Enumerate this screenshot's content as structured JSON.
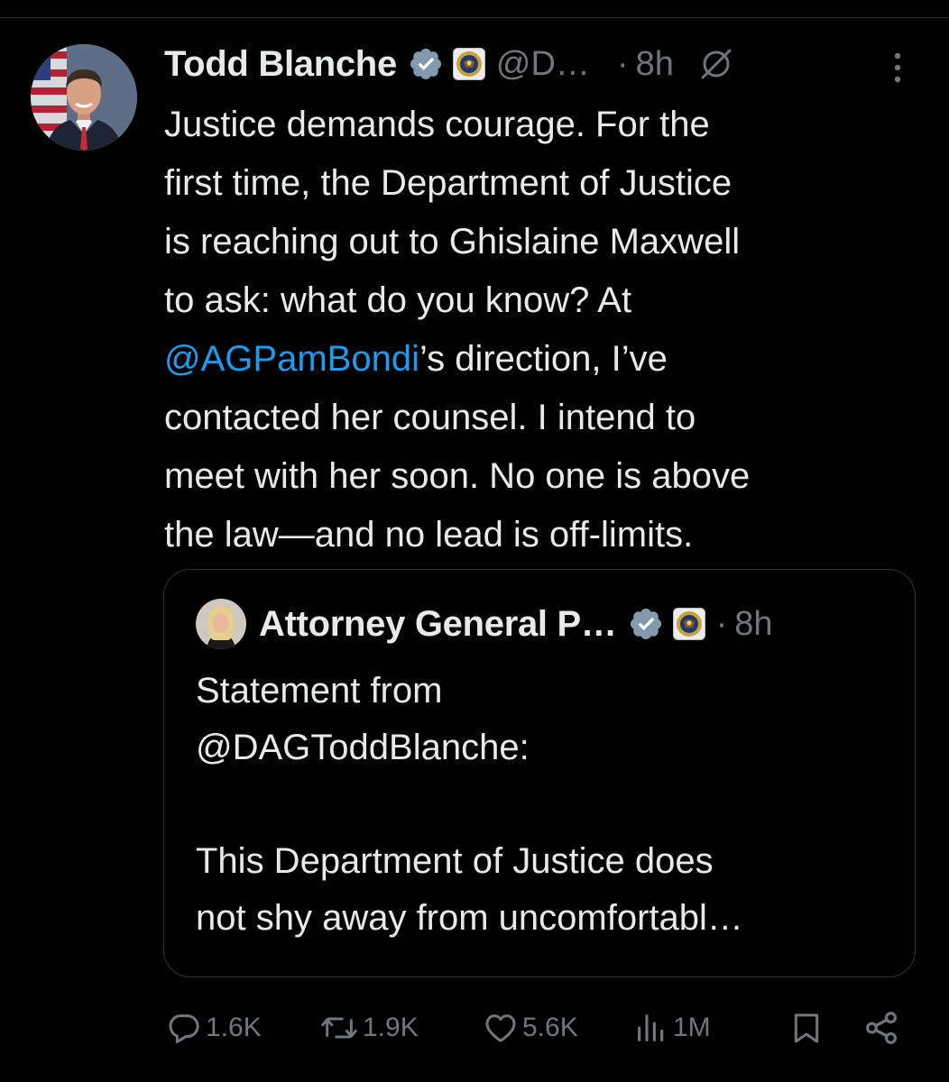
{
  "tweet": {
    "author_name": "Todd Blanche",
    "handle": "@D…",
    "separator": "·",
    "time": "8h",
    "text_lines": [
      "Justice demands courage. For the",
      "first time, the Department of Justice",
      "is reaching out to Ghislaine Maxwell",
      "to ask: what do you know? At"
    ],
    "mention": "@AGPamBondi",
    "after_mention": "’s direction, I’ve",
    "text_lines_end": [
      "contacted her counsel. I intend to",
      "meet with her soon. No one is above",
      "the law—and no lead is off-limits."
    ]
  },
  "quoted": {
    "author_name": "Attorney General P…",
    "separator": "·",
    "time": "8h",
    "para1_line1": "Statement from",
    "para1_line2": "@DAGToddBlanche:",
    "para2_line1": "This Department of Justice does",
    "para2_line2": "not shy away from uncomfortabl…"
  },
  "actions": {
    "replies": "1.6K",
    "reposts": "1.9K",
    "likes": "5.6K",
    "views": "1M"
  },
  "colors": {
    "background": "#000000",
    "text": "#e7e9ea",
    "secondary": "#71767b",
    "link": "#1d9bf0",
    "verified_badge": "#829aab",
    "border": "#2f3336"
  },
  "icons": [
    "verified-badge-icon",
    "doj-seal-icon",
    "grok-icon",
    "more-icon",
    "reply-icon",
    "repost-icon",
    "like-icon",
    "views-icon",
    "bookmark-icon",
    "share-icon"
  ]
}
